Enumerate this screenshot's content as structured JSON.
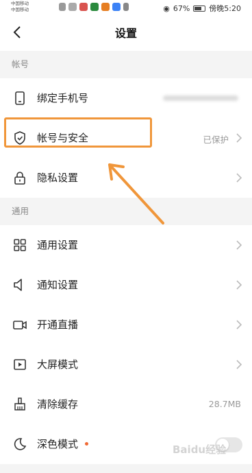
{
  "statusbar": {
    "carrier_1": "中国移动",
    "carrier_2": "中国移动",
    "battery": "67%",
    "time": "傍晚5:20"
  },
  "header": {
    "title": "设置"
  },
  "sections": {
    "account": "帐号",
    "general": "通用"
  },
  "rows": {
    "bind_phone": {
      "label": "绑定手机号"
    },
    "account_security": {
      "label": "帐号与安全",
      "value": "已保护"
    },
    "privacy": {
      "label": "隐私设置"
    },
    "general_settings": {
      "label": "通用设置"
    },
    "notification": {
      "label": "通知设置"
    },
    "live": {
      "label": "开通直播"
    },
    "big_screen": {
      "label": "大屏模式"
    },
    "clear_cache": {
      "label": "清除缓存",
      "value": "28.7MB"
    },
    "dark_mode": {
      "label": "深色模式",
      "toggle_on": false
    }
  },
  "annotation": {
    "highlight_color": "#f0963a"
  },
  "watermark": "Baidu经验"
}
